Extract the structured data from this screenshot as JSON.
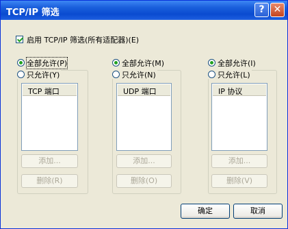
{
  "window": {
    "title": "TCP/IP 筛选",
    "help_glyph": "?",
    "close_glyph": "✕"
  },
  "enable_filter": {
    "label": "启用 TCP/IP 筛选(所有适配器)(E)",
    "checked": true
  },
  "groups": [
    {
      "permit_all": "全部允许(P)",
      "permit_only": "只允许(Y)",
      "list_header": "TCP 端口",
      "add": "添加...",
      "remove": "删除(R)"
    },
    {
      "permit_all": "全部允许(M)",
      "permit_only": "只允许(N)",
      "list_header": "UDP 端口",
      "add": "添加...",
      "remove": "删除(O)"
    },
    {
      "permit_all": "全部允许(I)",
      "permit_only": "只允许(L)",
      "list_header": "IP 协议",
      "add": "添加...",
      "remove": "删除(V)"
    }
  ],
  "buttons": {
    "ok": "确定",
    "cancel": "取消"
  }
}
